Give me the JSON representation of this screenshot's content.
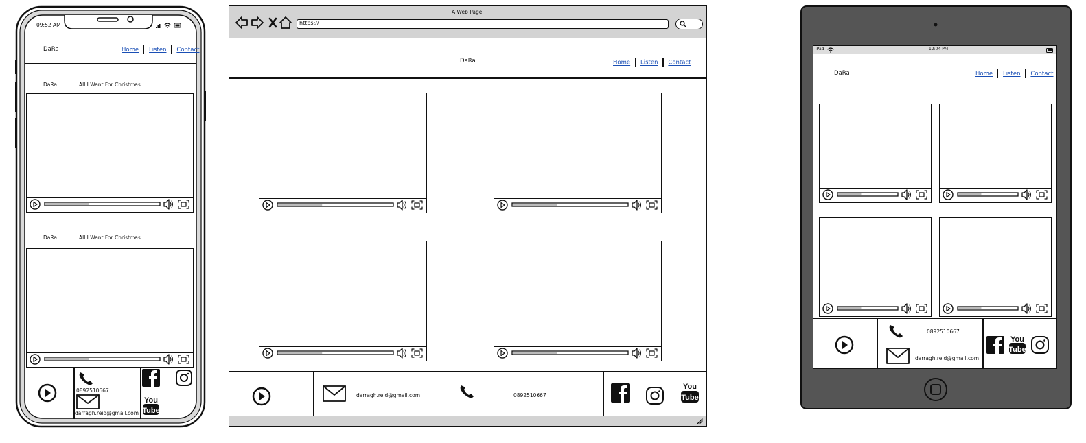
{
  "site": {
    "brand": "DaRa",
    "nav": [
      "Home",
      "Listen",
      "Contact"
    ]
  },
  "phone": {
    "status_time": "09:52 AM",
    "videos": [
      {
        "artist": "DaRa",
        "title": "All I Want For Christmas"
      },
      {
        "artist": "DaRa",
        "title": "All I Want For Christmas"
      }
    ]
  },
  "browser": {
    "window_title": "A Web Page",
    "url": "https://"
  },
  "tablet": {
    "status_left": "iPad",
    "status_time": "12:04 PM"
  },
  "contact": {
    "phone": "0892510667",
    "email": "darragh.reid@gmail.com"
  },
  "video_progress": 0.38,
  "icons": [
    "back-arrow-icon",
    "forward-arrow-icon",
    "close-icon",
    "home-icon",
    "search-icon",
    "play-circle-icon",
    "mail-icon",
    "phone-icon",
    "facebook-icon",
    "instagram-icon",
    "youtube-icon",
    "speaker-icon",
    "fullscreen-icon",
    "wifi-icon",
    "battery-icon",
    "signal-icon"
  ]
}
